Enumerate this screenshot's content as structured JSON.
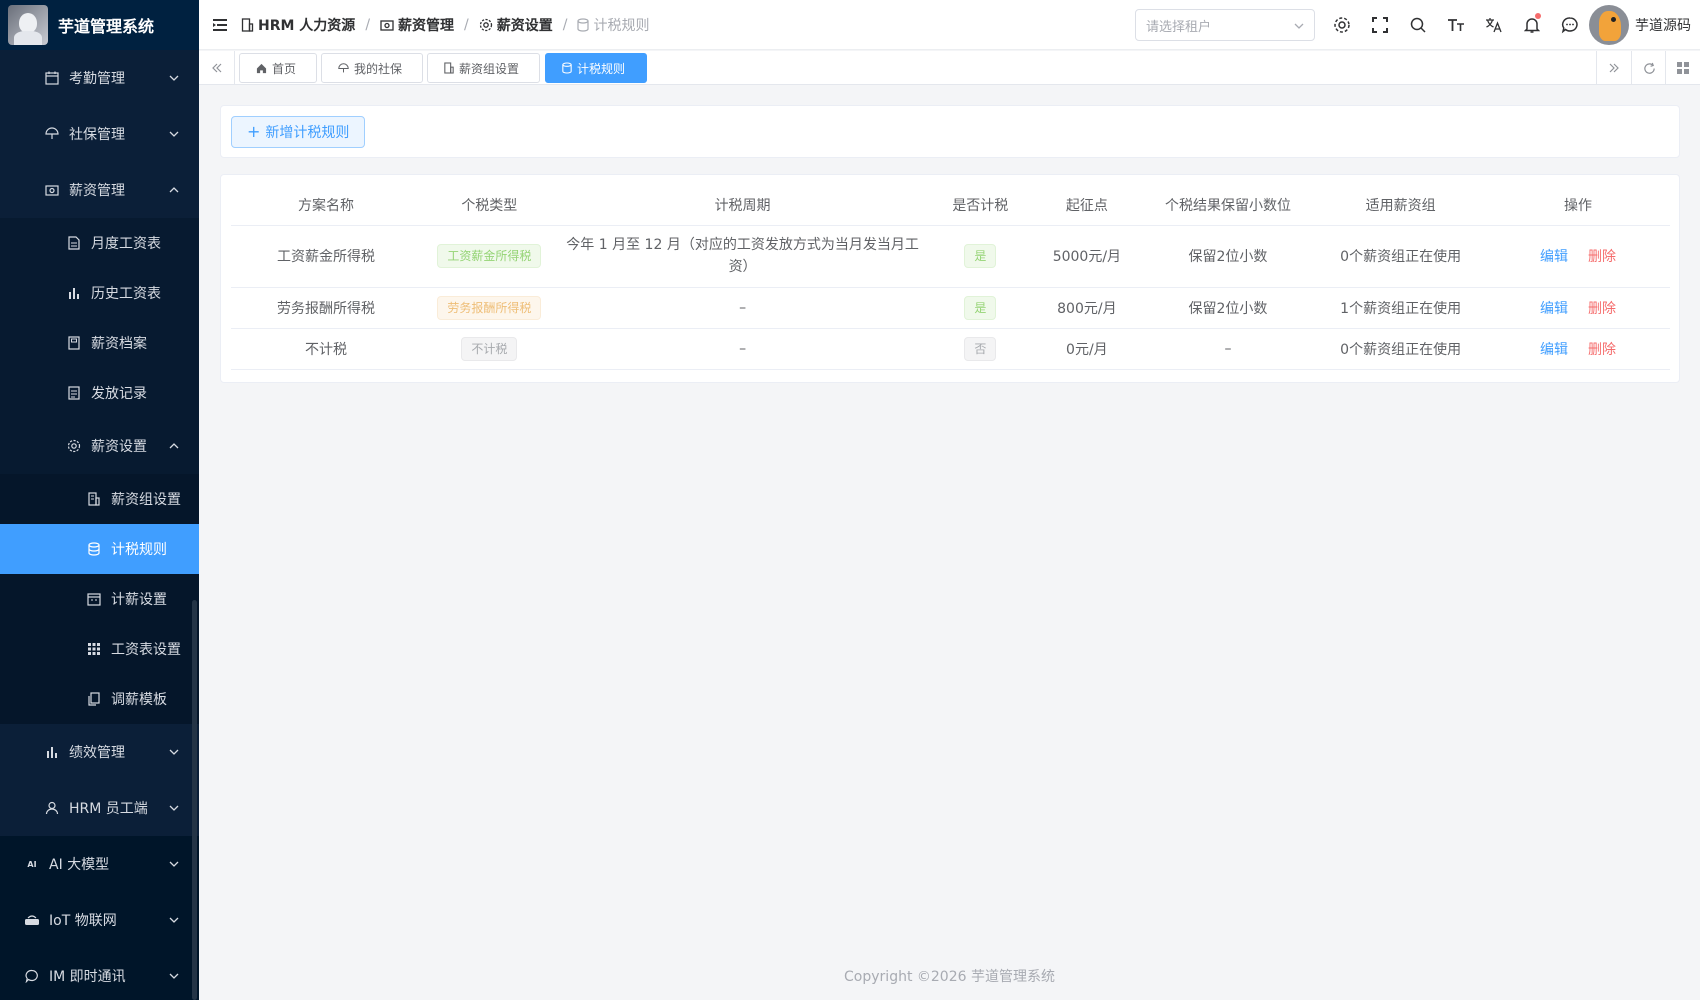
{
  "app": {
    "title": "芋道管理系统"
  },
  "sidebar": {
    "items": [
      {
        "label": "考勤管理",
        "icon": "calendar-icon"
      },
      {
        "label": "社保管理",
        "icon": "umbrella-icon"
      },
      {
        "label": "薪资管理",
        "icon": "money-icon"
      },
      {
        "label": "月度工资表",
        "icon": "document-icon"
      },
      {
        "label": "历史工资表",
        "icon": "bar-chart-icon"
      },
      {
        "label": "薪资档案",
        "icon": "archive-icon"
      },
      {
        "label": "发放记录",
        "icon": "record-icon"
      },
      {
        "label": "薪资设置",
        "icon": "gear-icon"
      },
      {
        "label": "薪资组设置",
        "icon": "building-icon"
      },
      {
        "label": "计税规则",
        "icon": "database-icon"
      },
      {
        "label": "计薪设置",
        "icon": "calendar-icon"
      },
      {
        "label": "工资表设置",
        "icon": "grid-icon"
      },
      {
        "label": "调薪模板",
        "icon": "copy-icon"
      },
      {
        "label": "绩效管理",
        "icon": "bar-chart-icon"
      },
      {
        "label": "HRM 员工端",
        "icon": "user-icon"
      },
      {
        "label": "AI 大模型",
        "icon": "ai-icon"
      },
      {
        "label": "IoT 物联网",
        "icon": "router-icon"
      },
      {
        "label": "IM 即时通讯",
        "icon": "chat-icon"
      }
    ]
  },
  "header": {
    "breadcrumb": [
      "HRM 人力资源",
      "薪资管理",
      "薪资设置",
      "计税规则"
    ],
    "tenant_placeholder": "请选择租户",
    "user_name": "芋道源码"
  },
  "tabs": [
    "首页",
    "我的社保",
    "薪资组设置",
    "计税规则"
  ],
  "toolbar": {
    "add_label": "新增计税规则"
  },
  "table": {
    "headers": [
      "方案名称",
      "个税类型",
      "计税周期",
      "是否计税",
      "起征点",
      "个税结果保留小数位",
      "适用薪资组",
      "操作"
    ],
    "rows": [
      {
        "name": "工资薪金所得税",
        "type": "工资薪金所得税",
        "type_color": "green",
        "period": "今年 1 月至 12 月（对应的工资发放方式为当月发当月工资）",
        "taxable": "是",
        "threshold": "5000元/月",
        "decimals": "保留2位小数",
        "groups": "0个薪资组正在使用",
        "edit": "编辑",
        "delete": "删除"
      },
      {
        "name": "劳务报酬所得税",
        "type": "劳务报酬所得税",
        "type_color": "orange",
        "period": "–",
        "taxable": "是",
        "threshold": "800元/月",
        "decimals": "保留2位小数",
        "groups": "1个薪资组正在使用",
        "edit": "编辑",
        "delete": "删除"
      },
      {
        "name": "不计税",
        "type": "不计税",
        "type_color": "gray",
        "period": "–",
        "taxable": "否",
        "threshold": "0元/月",
        "decimals": "–",
        "groups": "0个薪资组正在使用",
        "edit": "编辑",
        "delete": "删除"
      }
    ]
  },
  "footer": {
    "copyright": "Copyright ©2026 芋道管理系统"
  },
  "colors": {
    "primary": "#409eff",
    "danger": "#f56c6c",
    "sidebar_bg": "#001529"
  }
}
